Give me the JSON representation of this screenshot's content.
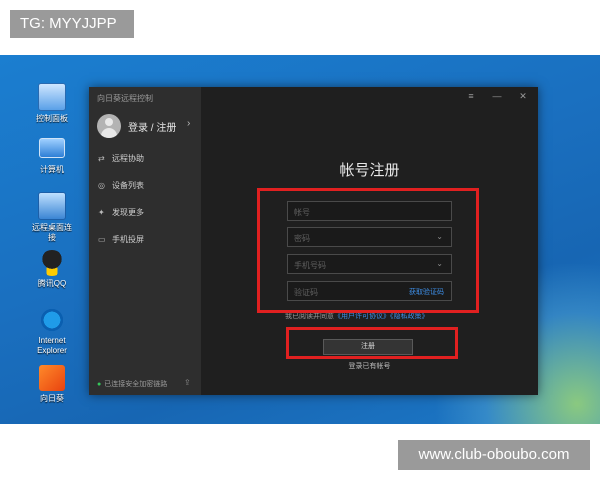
{
  "overlay": {
    "tag": "TG: MYYJJPP",
    "watermark": "www.club-oboubo.com"
  },
  "desktop": {
    "icons": [
      {
        "label": "控制面板",
        "icon": "control-panel-icon"
      },
      {
        "label": "计算机",
        "icon": "computer-icon"
      },
      {
        "label": "远程桌面连接",
        "icon": "remote-desktop-icon"
      },
      {
        "label": "腾讯QQ",
        "icon": "qq-penguin-icon"
      },
      {
        "label": "Internet Explorer",
        "icon": "ie-icon"
      },
      {
        "label": "向日葵",
        "icon": "sunlogin-icon"
      }
    ]
  },
  "window": {
    "title": "向日葵远程控制",
    "controls": [
      "≡",
      "—",
      "✕"
    ],
    "sidebar": {
      "login_label": "登录 / 注册",
      "items": [
        {
          "label": "远程协助",
          "icon": "remote-assist-icon"
        },
        {
          "label": "设备列表",
          "icon": "device-list-icon"
        },
        {
          "label": "发现更多",
          "icon": "discover-icon"
        },
        {
          "label": "手机投屏",
          "icon": "screen-cast-icon"
        }
      ],
      "footer": "已连接安全加密链路"
    },
    "form": {
      "title": "帐号注册",
      "account_placeholder": "帐号",
      "password_placeholder": "密码",
      "phone_placeholder": "手机号码",
      "code_placeholder": "验证码",
      "get_code": "获取验证码",
      "agree_prefix": "我已阅读并同意",
      "agree_link1": "《用户许可协议》",
      "agree_link2": "《隐私政策》",
      "register_button": "注册",
      "have_account": "登录已有帐号"
    }
  },
  "colors": {
    "accent": "#3d8ee6",
    "highlight_box": "#e02020",
    "window_bg": "#1f1f1f",
    "sidebar_bg": "#2e2e2e"
  }
}
